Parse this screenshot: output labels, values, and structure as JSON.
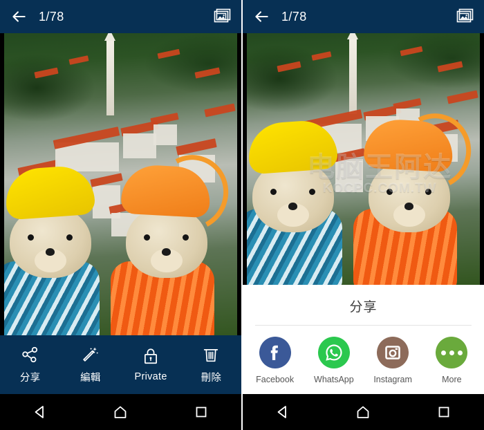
{
  "left_screen": {
    "appbar": {
      "back_icon": "arrow-left-icon",
      "counter": "1/78",
      "gallery_icon": "gallery-icon",
      "background_color": "#073054"
    },
    "actions": [
      {
        "icon": "share-nodes-icon",
        "label": "分享"
      },
      {
        "icon": "magic-wand-icon",
        "label": "編輯"
      },
      {
        "icon": "lock-icon",
        "label": "Private"
      },
      {
        "icon": "trash-icon",
        "label": "刪除"
      }
    ]
  },
  "right_screen": {
    "appbar": {
      "back_icon": "arrow-left-icon",
      "counter": "1/78",
      "gallery_icon": "gallery-icon",
      "background_color": "#073054"
    },
    "share_sheet": {
      "title": "分享",
      "targets": [
        {
          "name": "Facebook",
          "icon": "facebook-icon",
          "color": "#3B5998"
        },
        {
          "name": "WhatsApp",
          "icon": "whatsapp-icon",
          "color": "#2BC84E"
        },
        {
          "name": "Instagram",
          "icon": "instagram-icon",
          "color": "#8D6B5A"
        },
        {
          "name": "More",
          "icon": "more-dots-icon",
          "color": "#6AAA3C"
        }
      ]
    },
    "watermark": {
      "line1": "电脑王阿达",
      "line2": "KOCPC.COM.TW"
    }
  },
  "navbar": {
    "back_label": "Back",
    "home_label": "Home",
    "recents_label": "Recents",
    "background_color": "#000000"
  }
}
